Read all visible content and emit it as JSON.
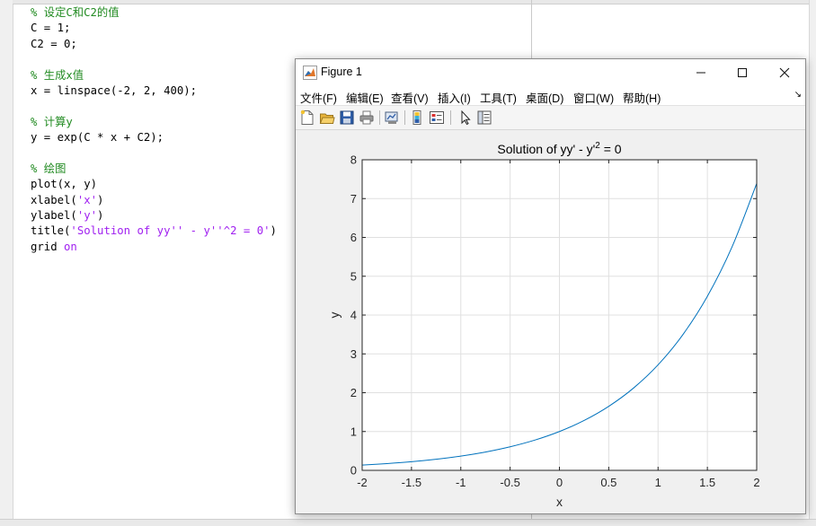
{
  "editor": {
    "lines": [
      {
        "parts": [
          {
            "t": "% 设定C和C2的值",
            "c": "cmt"
          }
        ]
      },
      {
        "parts": [
          {
            "t": "C = 1;",
            "c": ""
          }
        ]
      },
      {
        "parts": [
          {
            "t": "C2 = 0;",
            "c": ""
          }
        ]
      },
      {
        "parts": []
      },
      {
        "parts": [
          {
            "t": "% 生成x值",
            "c": "cmt"
          }
        ]
      },
      {
        "parts": [
          {
            "t": "x = linspace(-2, 2, 400);",
            "c": ""
          }
        ]
      },
      {
        "parts": []
      },
      {
        "parts": [
          {
            "t": "% 计算y",
            "c": "cmt"
          }
        ]
      },
      {
        "parts": [
          {
            "t": "y = exp(C * x + C2);",
            "c": ""
          }
        ]
      },
      {
        "parts": []
      },
      {
        "parts": [
          {
            "t": "% 绘图",
            "c": "cmt"
          }
        ]
      },
      {
        "parts": [
          {
            "t": "plot(x, y)",
            "c": ""
          }
        ]
      },
      {
        "parts": [
          {
            "t": "xlabel(",
            "c": ""
          },
          {
            "t": "'x'",
            "c": "str"
          },
          {
            "t": ")",
            "c": ""
          }
        ]
      },
      {
        "parts": [
          {
            "t": "ylabel(",
            "c": ""
          },
          {
            "t": "'y'",
            "c": "str"
          },
          {
            "t": ")",
            "c": ""
          }
        ]
      },
      {
        "parts": [
          {
            "t": "title(",
            "c": ""
          },
          {
            "t": "'Solution of yy'' - y''^2 = 0'",
            "c": "str"
          },
          {
            "t": ")",
            "c": ""
          }
        ]
      },
      {
        "parts": [
          {
            "t": "grid ",
            "c": ""
          },
          {
            "t": "on",
            "c": "kw"
          }
        ]
      }
    ]
  },
  "figure": {
    "window_title": "Figure 1",
    "menu": [
      "文件(F)",
      "编辑(E)",
      "查看(V)",
      "插入(I)",
      "工具(T)",
      "桌面(D)",
      "窗口(W)",
      "帮助(H)"
    ],
    "toolbar_icons": [
      "new-figure-icon",
      "open-file-icon",
      "save-icon",
      "print-icon",
      "link-plot-icon",
      "insert-colorbar-icon",
      "insert-legend-icon",
      "edit-plot-icon",
      "property-inspector-icon"
    ],
    "colors": {
      "line": "#0072bd",
      "axes_bg": "#ffffff",
      "grid": "#e0e0e0"
    }
  },
  "chart_data": {
    "type": "line",
    "title": "Solution of yy' - y'^2 = 0",
    "title_main": "Solution of yy' - y'",
    "title_sup": "2",
    "title_end": " = 0",
    "xlabel": "x",
    "ylabel": "y",
    "xlim": [
      -2,
      2
    ],
    "ylim": [
      0,
      8
    ],
    "xticks": [
      "-2",
      "-1.5",
      "-1",
      "-0.5",
      "0",
      "0.5",
      "1",
      "1.5",
      "2"
    ],
    "yticks": [
      "0",
      "1",
      "2",
      "3",
      "4",
      "5",
      "6",
      "7",
      "8"
    ],
    "grid": true,
    "series": [
      {
        "x": [
          -2,
          -1.75,
          -1.5,
          -1.25,
          -1,
          -0.75,
          -0.5,
          -0.25,
          0,
          0.25,
          0.5,
          0.75,
          1,
          1.25,
          1.5,
          1.75,
          2
        ],
        "values": [
          0.135,
          0.174,
          0.223,
          0.287,
          0.368,
          0.472,
          0.607,
          0.779,
          1.0,
          1.284,
          1.649,
          2.117,
          2.718,
          3.49,
          4.482,
          5.755,
          7.389
        ]
      }
    ]
  }
}
